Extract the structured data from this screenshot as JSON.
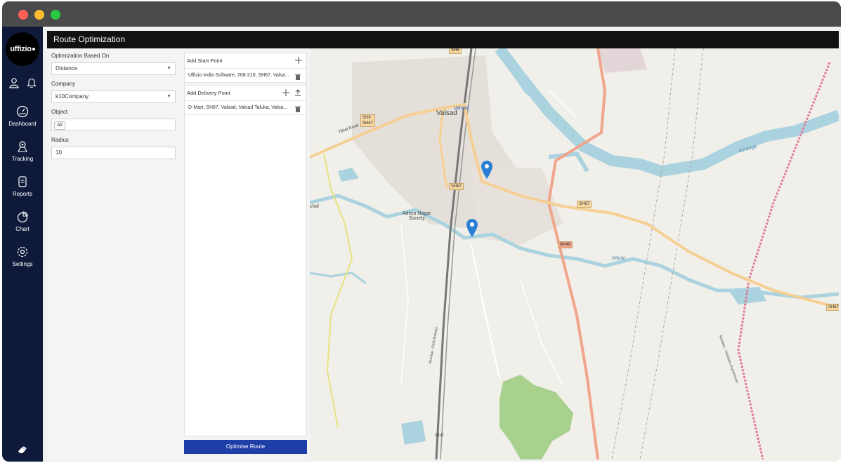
{
  "header": {
    "title": "Route Optimization"
  },
  "sidebar": {
    "logo": "uffizio",
    "items": [
      {
        "label": "Dashboard",
        "icon": "dashboard-icon"
      },
      {
        "label": "Tracking",
        "icon": "tracking-icon"
      },
      {
        "label": "Reports",
        "icon": "reports-icon"
      },
      {
        "label": "Chart",
        "icon": "chart-icon"
      },
      {
        "label": "Settings",
        "icon": "settings-icon"
      }
    ],
    "top_icons": [
      "user-icon",
      "bell-icon"
    ],
    "bottom_icon": "eraser-icon"
  },
  "form": {
    "optimization_label": "Optimization Based On",
    "optimization_value": "Distance",
    "company_label": "Company",
    "company_value": "k10Company",
    "object_label": "Object",
    "object_chip": "All",
    "radius_label": "Radius",
    "radius_value": "10"
  },
  "points": {
    "start_label": "Add Start Point",
    "start_value": "Uffizio India Software, 208-210, SH67, Valsa...",
    "delivery_label": "Add Delivery Point",
    "delivery_value": "D-Mart, SH67, Valsad, Valsad Taluka, Valsa..."
  },
  "actions": {
    "optimise_label": "Optimise Route"
  },
  "map": {
    "labels": {
      "valsad": "Valsad",
      "valsad_station": "Valsad",
      "aditya_nagar": "Aditya Nagar\nSociety",
      "atul": "Atul",
      "chal": "chal",
      "tithal_road": "Tithal Road",
      "wanki": "Wanki",
      "auranga": "Auranga",
      "western_railway": "Mumbai - Delhi Railway",
      "expressway": "Mumbai - Vadodara Expressway"
    },
    "shields": {
      "sh6": "SH6\nSH67",
      "sh67_a": "SH67",
      "sh67_b": "SH67",
      "sh67_c": "SH67",
      "nh48": "NH48",
      "sh6_top": "SH6"
    },
    "colors": {
      "land": "#f1efe9",
      "water": "#aad3df",
      "highway": "#f0a58c",
      "state_road": "#f6cf94",
      "forest": "#a9d18e",
      "railway": "#888888",
      "pin": "#2a7fd4"
    }
  }
}
